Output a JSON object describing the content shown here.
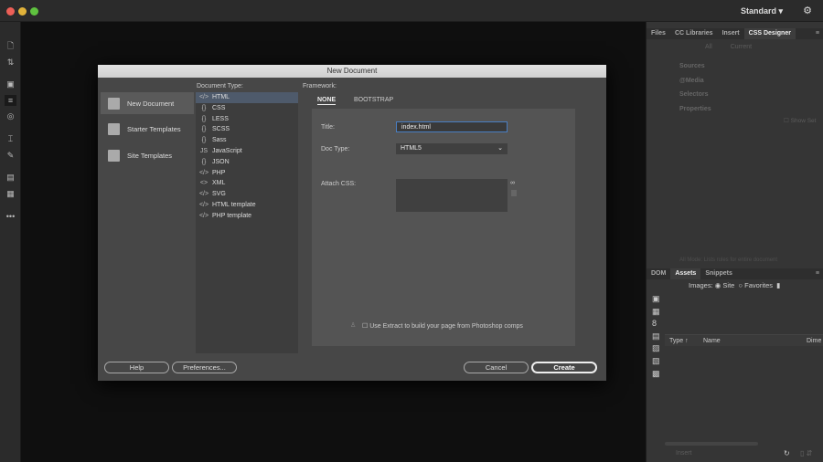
{
  "window": {
    "workspace": "Standard",
    "colors": {
      "close": "#ec5f57",
      "minimize": "#e1b23a",
      "zoom": "#5fc23f",
      "accent": "#4a7ec2"
    }
  },
  "left_toolbar": {
    "icons": [
      "new-file-icon",
      "file-transfer-icon",
      "live-view-icon",
      "code-format-icon",
      "inspect-icon",
      "insert-icon",
      "pen-icon",
      "comment-icon",
      "snippet-icon",
      "more-icon"
    ]
  },
  "right_panel": {
    "top_tabs": [
      "Files",
      "CC Libraries",
      "Insert",
      "CSS Designer"
    ],
    "css_designer": {
      "toggle": [
        "All",
        "Current"
      ],
      "sections": [
        "Sources",
        "@Media",
        "Selectors",
        "Properties"
      ],
      "show_set": "Show Set",
      "hint": "All Mode: Lists rules for entire document"
    },
    "bottom_tabs": [
      "DOM",
      "Assets",
      "Snippets"
    ],
    "assets": {
      "images_label": "Images:",
      "site": "Site",
      "favorites": "Favorites",
      "columns": [
        "Type ↑",
        "Name",
        "Dime"
      ],
      "insert": "Insert"
    }
  },
  "dialog": {
    "title": "New Document",
    "categories": [
      "New Document",
      "Starter Templates",
      "Site Templates"
    ],
    "doc_type_label": "Document Type:",
    "doc_types": [
      [
        "</>",
        "HTML"
      ],
      [
        "{}",
        "CSS"
      ],
      [
        "{}",
        "LESS"
      ],
      [
        "{}",
        "SCSS"
      ],
      [
        "{}",
        "Sass"
      ],
      [
        "JS",
        "JavaScript"
      ],
      [
        "{}",
        "JSON"
      ],
      [
        "</>",
        "PHP"
      ],
      [
        "<>",
        "XML"
      ],
      [
        "</>",
        "SVG"
      ],
      [
        "</>",
        "HTML template"
      ],
      [
        "</>",
        "PHP template"
      ]
    ],
    "framework_label": "Framework:",
    "framework_tabs": [
      "NONE",
      "BOOTSTRAP"
    ],
    "title_label": "Title:",
    "title_value": "index.html",
    "doctype_label": "Doc Type:",
    "doctype_value": "HTML5",
    "attach_label": "Attach CSS:",
    "extract": "Use Extract to build your page from Photoshop comps",
    "buttons": {
      "help": "Help",
      "preferences": "Preferences...",
      "cancel": "Cancel",
      "create": "Create"
    }
  }
}
